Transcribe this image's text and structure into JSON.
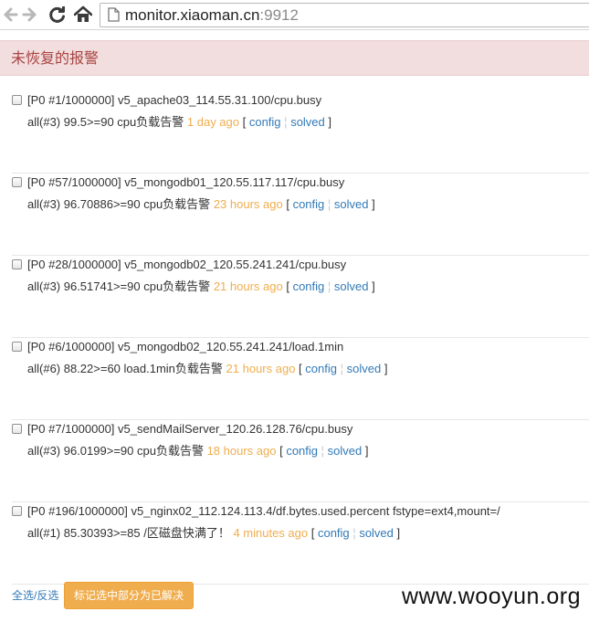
{
  "browser": {
    "url_host": "monitor.xiaoman.cn",
    "url_port": ":9912"
  },
  "panel": {
    "title": "未恢复的报警"
  },
  "alerts": [
    {
      "title": "[P0 #1/1000000] v5_apache03_114.55.31.100/cpu.busy",
      "detail": "all(#3) 99.5>=90 cpu负载告警",
      "ago": "1 day ago",
      "config_label": "config",
      "solved_label": "solved"
    },
    {
      "title": "[P0 #57/1000000] v5_mongodb01_120.55.117.117/cpu.busy",
      "detail": "all(#3) 96.70886>=90 cpu负载告警",
      "ago": "23 hours ago",
      "config_label": "config",
      "solved_label": "solved"
    },
    {
      "title": "[P0 #28/1000000] v5_mongodb02_120.55.241.241/cpu.busy",
      "detail": "all(#3) 96.51741>=90 cpu负载告警",
      "ago": "21 hours ago",
      "config_label": "config",
      "solved_label": "solved"
    },
    {
      "title": "[P0 #6/1000000] v5_mongodb02_120.55.241.241/load.1min",
      "detail": "all(#6) 88.22>=60 load.1min负载告警",
      "ago": "21 hours ago",
      "config_label": "config",
      "solved_label": "solved"
    },
    {
      "title": "[P0 #7/1000000] v5_sendMailServer_120.26.128.76/cpu.busy",
      "detail": "all(#3) 96.0199>=90 cpu负载告警",
      "ago": "18 hours ago",
      "config_label": "config",
      "solved_label": "solved"
    },
    {
      "title": "[P0 #196/1000000] v5_nginx02_112.124.113.4/df.bytes.used.percent fstype=ext4,mount=/",
      "detail": "all(#1) 85.30393>=85 /区磁盘快满了！",
      "ago": "4 minutes ago",
      "config_label": "config",
      "solved_label": "solved"
    }
  ],
  "footer": {
    "select_all": "全选",
    "divider": "/",
    "invert": "反选",
    "mark_solved_button": "标记选中部分为已解决"
  },
  "watermark": "www.wooyun.org",
  "colors": {
    "header_bg": "#f2dede",
    "header_text": "#a94442",
    "link": "#337ab7",
    "time_ago": "#f0ad4e",
    "button_bg": "#f0ad4e"
  },
  "icons": {
    "back": "arrow-left-icon",
    "forward": "arrow-right-icon",
    "reload": "reload-icon",
    "home": "home-icon",
    "page": "page-icon"
  }
}
